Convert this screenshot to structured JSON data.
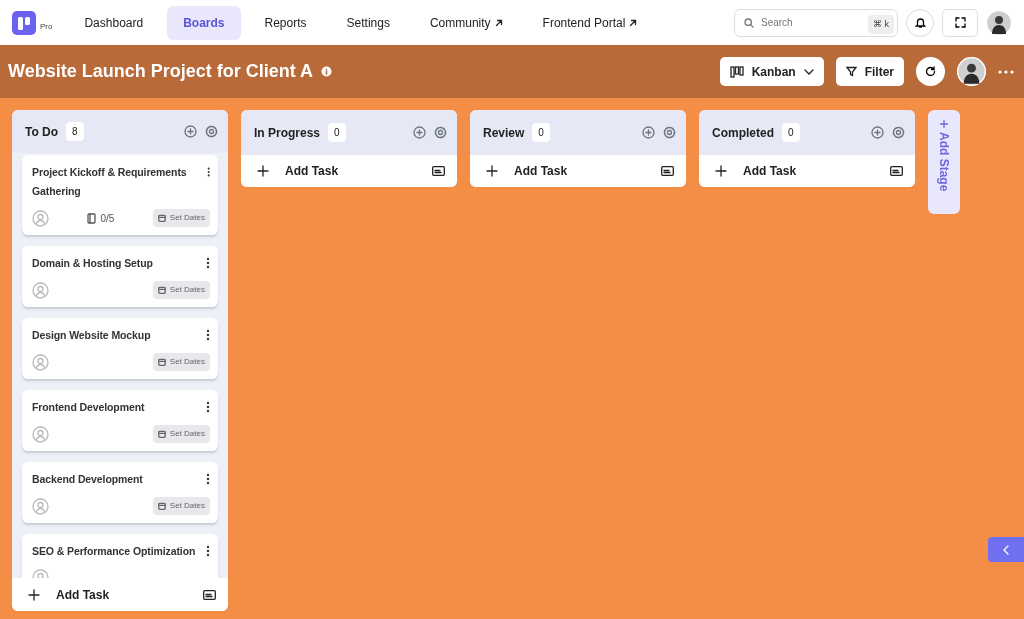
{
  "logo": {
    "badge": "Pro"
  },
  "nav": [
    {
      "label": "Dashboard",
      "selected": false,
      "external": false
    },
    {
      "label": "Boards",
      "selected": true,
      "external": false
    },
    {
      "label": "Reports",
      "selected": false,
      "external": false
    },
    {
      "label": "Settings",
      "selected": false,
      "external": false
    },
    {
      "label": "Community",
      "selected": false,
      "external": true
    },
    {
      "label": "Frontend Portal",
      "selected": false,
      "external": true
    }
  ],
  "search": {
    "placeholder": "Search",
    "shortcut": "⌘ k"
  },
  "board": {
    "title": "Website Launch Project for Client A",
    "view": "Kanban",
    "filter": "Filter"
  },
  "columns": [
    {
      "name": "To Do",
      "count": "8",
      "add_task": "Add Task",
      "tasks": [
        {
          "title": "Project Kickoff & Requirements Gathering",
          "subtasks": "0/5",
          "dates": "Set Dates"
        },
        {
          "title": "Domain & Hosting Setup",
          "dates": "Set Dates"
        },
        {
          "title": "Design Website Mockup",
          "dates": "Set Dates"
        },
        {
          "title": "Frontend Development",
          "dates": "Set Dates"
        },
        {
          "title": "Backend Development",
          "dates": "Set Dates"
        },
        {
          "title": "SEO & Performance Optimization"
        }
      ]
    },
    {
      "name": "In Progress",
      "count": "0",
      "add_task": "Add Task"
    },
    {
      "name": "Review",
      "count": "0",
      "add_task": "Add Task"
    },
    {
      "name": "Completed",
      "count": "0",
      "add_task": "Add Task"
    }
  ],
  "add_stage": "Add Stage"
}
